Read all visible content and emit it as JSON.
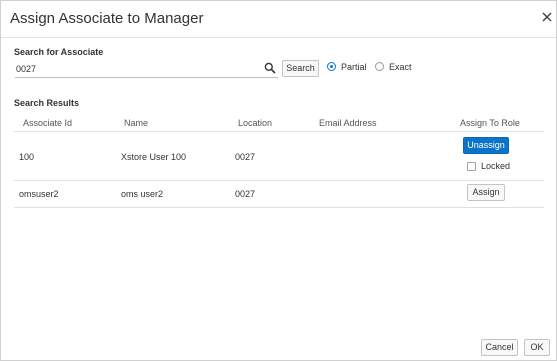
{
  "dialog": {
    "title": "Assign Associate to Manager"
  },
  "search": {
    "label": "Search for Associate",
    "value": "0027",
    "button_label": "Search",
    "mode_options": [
      {
        "label": "Partial",
        "selected": true
      },
      {
        "label": "Exact",
        "selected": false
      }
    ]
  },
  "results": {
    "label": "Search Results",
    "columns": [
      "Associate Id",
      "Name",
      "Location",
      "Email Address",
      "Assign To Role"
    ],
    "rows": [
      {
        "associate_id": "100",
        "name": "Xstore User 100",
        "location": "0027",
        "email": "",
        "action_label": "Unassign",
        "locked_label": "Locked",
        "locked_checked": false
      },
      {
        "associate_id": "omsuser2",
        "name": "oms user2",
        "location": "0027",
        "email": "",
        "action_label": "Assign"
      }
    ]
  },
  "footer": {
    "cancel_label": "Cancel",
    "ok_label": "OK"
  },
  "colors": {
    "primary": "#0b74c8",
    "border": "#e1e1e1"
  }
}
